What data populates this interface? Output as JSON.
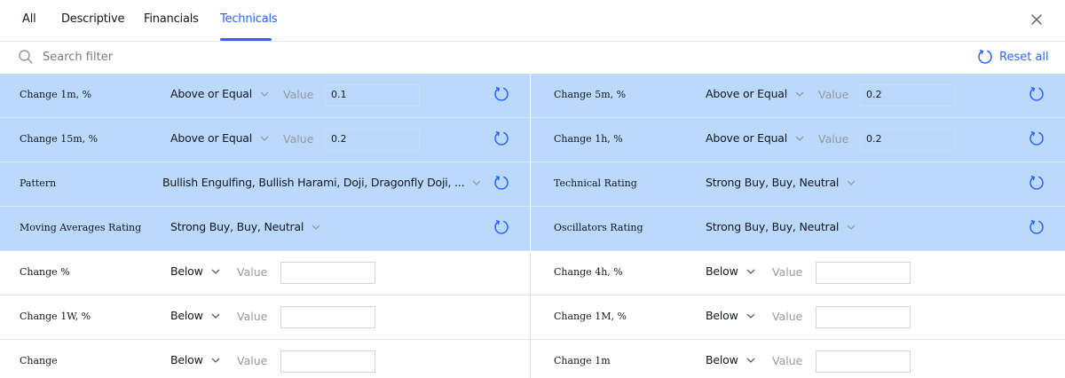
{
  "tabs": [
    {
      "label": "All"
    },
    {
      "label": "Descriptive"
    },
    {
      "label": "Financials"
    },
    {
      "label": "Technicals"
    }
  ],
  "active_tab": "Technicals",
  "search": {
    "placeholder": "Search filter",
    "value": ""
  },
  "reset_all_label": "Reset all",
  "value_placeholder": "Value",
  "filters": [
    {
      "label": "Change 1m, %",
      "operator": "Above or Equal",
      "value": "0.1",
      "active": true
    },
    {
      "label": "Change 5m, %",
      "operator": "Above or Equal",
      "value": "0.2",
      "active": true
    },
    {
      "label": "Change 15m, %",
      "operator": "Above or Equal",
      "value": "0.2",
      "active": true
    },
    {
      "label": "Change 1h, %",
      "operator": "Above or Equal",
      "value": "0.2",
      "active": true
    },
    {
      "label": "Pattern",
      "operator": "Bullish Engulfing, Bullish Harami, Doji, Dragonfly Doji, ...",
      "active": true
    },
    {
      "label": "Technical Rating",
      "operator": "Strong Buy, Buy, Neutral",
      "active": true
    },
    {
      "label": "Moving Averages Rating",
      "operator": "Strong Buy, Buy, Neutral",
      "active": true
    },
    {
      "label": "Oscillators Rating",
      "operator": "Strong Buy, Buy, Neutral",
      "active": true
    },
    {
      "label": "Change %",
      "operator": "Below",
      "value": "",
      "active": false
    },
    {
      "label": "Change 4h, %",
      "operator": "Below",
      "value": "",
      "active": false
    },
    {
      "label": "Change 1W, %",
      "operator": "Below",
      "value": "",
      "active": false
    },
    {
      "label": "Change 1M, %",
      "operator": "Below",
      "value": "",
      "active": false
    },
    {
      "label": "Change",
      "operator": "Below",
      "value": "",
      "active": false
    },
    {
      "label": "Change 1m",
      "operator": "Below",
      "value": "",
      "active": false
    }
  ],
  "colors": {
    "accent": "#2962ff",
    "active_row": "#bbd9fb",
    "muted_text": "#9598a1"
  },
  "icons": {
    "search": "search-icon",
    "close": "close-icon",
    "reset": "reset-icon",
    "chevron": "chevron-down-icon"
  }
}
